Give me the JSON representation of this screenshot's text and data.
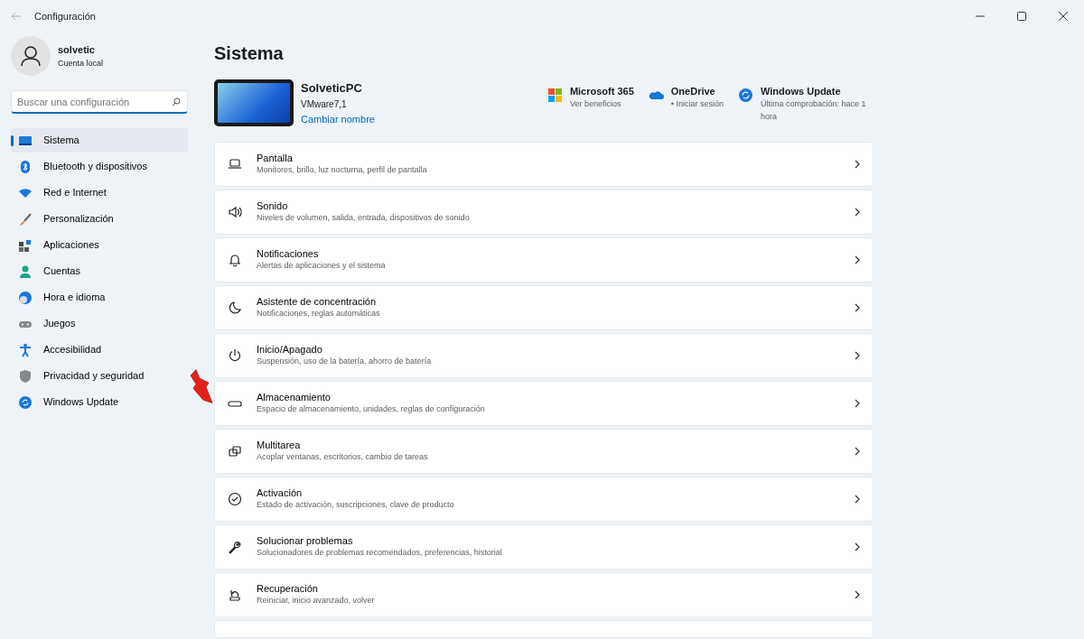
{
  "window": {
    "title": "Configuración"
  },
  "user": {
    "name": "solvetic",
    "account": "Cuenta local"
  },
  "search": {
    "placeholder": "Buscar una configuración"
  },
  "sidebar": {
    "items": [
      {
        "label": "Sistema",
        "kind": "system",
        "selected": true
      },
      {
        "label": "Bluetooth y dispositivos",
        "kind": "bluetooth",
        "selected": false
      },
      {
        "label": "Red e Internet",
        "kind": "network",
        "selected": false
      },
      {
        "label": "Personalización",
        "kind": "brush",
        "selected": false
      },
      {
        "label": "Aplicaciones",
        "kind": "apps",
        "selected": false
      },
      {
        "label": "Cuentas",
        "kind": "person",
        "selected": false
      },
      {
        "label": "Hora e idioma",
        "kind": "clock",
        "selected": false
      },
      {
        "label": "Juegos",
        "kind": "gamepad",
        "selected": false
      },
      {
        "label": "Accesibilidad",
        "kind": "accessibility",
        "selected": false
      },
      {
        "label": "Privacidad y seguridad",
        "kind": "shield",
        "selected": false
      },
      {
        "label": "Windows Update",
        "kind": "update",
        "selected": false
      }
    ]
  },
  "page": {
    "title": "Sistema"
  },
  "device": {
    "name": "SolveticPC",
    "model": "VMware7,1",
    "rename_link": "Cambiar nombre"
  },
  "quick_links": [
    {
      "kind": "office",
      "title": "Microsoft 365",
      "subtitle": "Ver beneficios"
    },
    {
      "kind": "cloud",
      "title": "OneDrive",
      "subtitle": "• Iniciar sesión"
    },
    {
      "kind": "update",
      "title": "Windows Update",
      "subtitle": "Última comprobación: hace 1 hora"
    }
  ],
  "settings": [
    {
      "kind": "display",
      "title": "Pantalla",
      "subtitle": "Monitores, brillo, luz nocturna, perfil de pantalla"
    },
    {
      "kind": "sound",
      "title": "Sonido",
      "subtitle": "Niveles de volumen, salida, entrada, dispositivos de sonido"
    },
    {
      "kind": "bell",
      "title": "Notificaciones",
      "subtitle": "Alertas de aplicaciones y el sistema"
    },
    {
      "kind": "moon",
      "title": "Asistente de concentración",
      "subtitle": "Notificaciones, reglas automáticas"
    },
    {
      "kind": "power",
      "title": "Inicio/Apagado",
      "subtitle": "Suspensión, uso de la batería, ahorro de batería"
    },
    {
      "kind": "storage",
      "title": "Almacenamiento",
      "subtitle": "Espacio de almacenamiento, unidades, reglas de configuración"
    },
    {
      "kind": "multitask",
      "title": "Multitarea",
      "subtitle": "Acoplar ventanas, escritorios, cambio de tareas"
    },
    {
      "kind": "check",
      "title": "Activación",
      "subtitle": "Estado de activación, suscripciones, clave de producto"
    },
    {
      "kind": "wrench",
      "title": "Solucionar problemas",
      "subtitle": "Solucionadores de problemas recomendados, preferencias, historial"
    },
    {
      "kind": "recovery",
      "title": "Recuperación",
      "subtitle": "Reiniciar, inicio avanzado, volver"
    }
  ]
}
